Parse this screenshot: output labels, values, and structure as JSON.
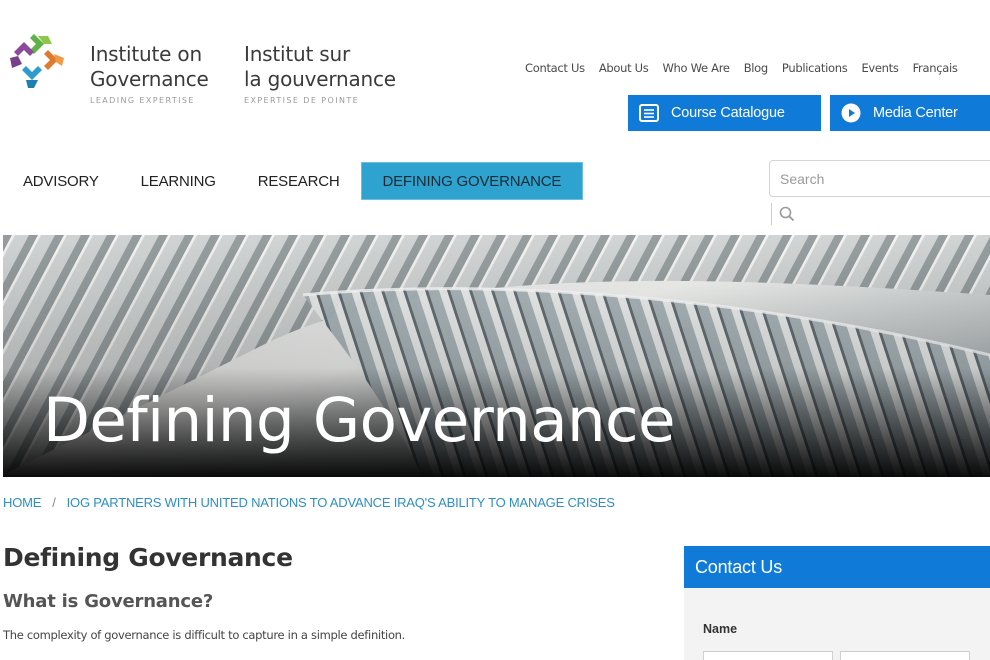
{
  "brand": {
    "en_line1": "Institute on",
    "en_line2": "Governance",
    "en_tagline": "LEADING EXPERTISE",
    "fr_line1": "Institut sur",
    "fr_line2": "la gouvernance",
    "fr_tagline": "EXPERTISE DE POINTE",
    "logo_colors": [
      "#8c4a9c",
      "#e07a2e",
      "#5fb346",
      "#2e9bd0"
    ]
  },
  "top_links": [
    {
      "label": "Contact Us"
    },
    {
      "label": "About Us"
    },
    {
      "label": "Who We Are"
    },
    {
      "label": "Blog"
    },
    {
      "label": "Publications"
    },
    {
      "label": "Events"
    },
    {
      "label": "Français"
    }
  ],
  "buttons": {
    "course_catalogue": {
      "label": "Course Catalogue",
      "icon": "catalogue-icon"
    },
    "media_center": {
      "label": "Media Center",
      "icon": "play-icon"
    }
  },
  "nav": {
    "items": [
      {
        "label": "ADVISORY"
      },
      {
        "label": "LEARNING"
      },
      {
        "label": "RESEARCH"
      },
      {
        "label": "DEFINING GOVERNANCE",
        "active": true
      }
    ]
  },
  "search": {
    "placeholder": "Search",
    "value": ""
  },
  "hero": {
    "title": "Defining Governance"
  },
  "breadcrumb": {
    "home": "HOME",
    "separator": "/",
    "current": "IOG PARTNERS WITH UNITED NATIONS TO ADVANCE IRAQ'S ABILITY TO MANAGE CRISES"
  },
  "content": {
    "title": "Defining Governance",
    "subtitle": "What is Governance?",
    "paragraph": "The complexity of governance is difficult to capture in a simple definition."
  },
  "contact": {
    "title": "Contact Us",
    "name_label": "Name"
  },
  "colors": {
    "accent_blue": "#0f7ad8",
    "nav_active": "#2ea3d0",
    "link": "#2d8fc4"
  }
}
